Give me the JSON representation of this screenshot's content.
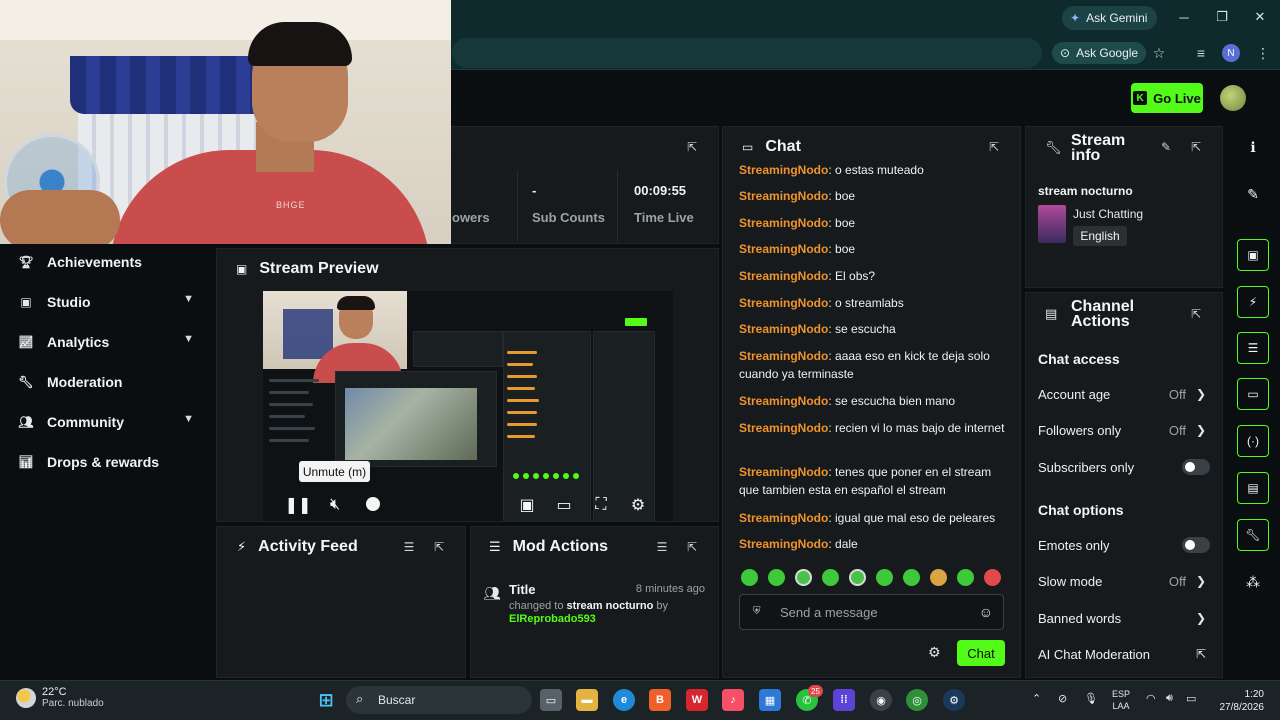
{
  "browser": {
    "ask_gemini": "Ask Gemini",
    "ask_google": "Ask Google",
    "profile_initial": "N",
    "minimize": "─",
    "maximize": "❐",
    "close": "✕"
  },
  "header": {
    "go_live_label": "Go Live",
    "go_live_logo": "K"
  },
  "webcam": {
    "shirt_text": "BHGE"
  },
  "sidebar": {
    "items": [
      {
        "label": "Achievements",
        "icon": "trophy-icon",
        "expandable": false
      },
      {
        "label": "Studio",
        "icon": "studio-icon",
        "expandable": true
      },
      {
        "label": "Analytics",
        "icon": "analytics-icon",
        "expandable": true
      },
      {
        "label": "Moderation",
        "icon": "wrench-icon",
        "expandable": false
      },
      {
        "label": "Community",
        "icon": "community-icon",
        "expandable": true
      },
      {
        "label": "Drops & rewards",
        "icon": "chart-icon",
        "expandable": false
      }
    ]
  },
  "stats": {
    "partial_label": "owers",
    "sub_counts_value": "-",
    "sub_counts_label": "Sub Counts",
    "time_live_value": "00:09:55",
    "time_live_label": "Time Live"
  },
  "stream_preview": {
    "title": "Stream Preview",
    "tooltip": "Unmute (m)"
  },
  "activity_feed": {
    "title": "Activity Feed"
  },
  "mod_actions": {
    "title": "Mod Actions",
    "entries": [
      {
        "title": "Title",
        "time": "8 minutes ago",
        "prefix": "changed to ",
        "value": "stream nocturno",
        "by": " by",
        "user": "ElReprobado593"
      }
    ]
  },
  "chat": {
    "title": "Chat",
    "messages": [
      {
        "user": "StreamingNodo",
        "text": "o estas muteado"
      },
      {
        "user": "StreamingNodo",
        "text": "boe"
      },
      {
        "user": "StreamingNodo",
        "text": "boe"
      },
      {
        "user": "StreamingNodo",
        "text": "boe"
      },
      {
        "user": "StreamingNodo",
        "text": "El obs?"
      },
      {
        "user": "StreamingNodo",
        "text": "o streamlabs"
      },
      {
        "user": "StreamingNodo",
        "text": "se escucha"
      },
      {
        "user": "StreamingNodo",
        "text": "aaaa eso en kick te deja solo cuando ya terminaste"
      },
      {
        "user": "StreamingNodo",
        "text": "se escucha bien mano"
      },
      {
        "user": "StreamingNodo",
        "text": "recien vi lo mas bajo de internet"
      },
      {
        "user": "StreamingNodo",
        "text": "tenes que poner en el stream que tambien esta en español el stream"
      },
      {
        "user": "StreamingNodo",
        "text": "igual que mal eso de peleares"
      },
      {
        "user": "StreamingNodo",
        "text": "dale"
      }
    ],
    "input_placeholder": "Send a message",
    "send_label": "Chat"
  },
  "stream_info": {
    "title_line1": "Stream",
    "title_line2": "info",
    "stream_title": "stream nocturno",
    "category": "Just Chatting",
    "language": "English"
  },
  "channel_actions": {
    "title_line1": "Channel",
    "title_line2": "Actions",
    "chat_access_heading": "Chat access",
    "account_age": {
      "label": "Account age",
      "value": "Off"
    },
    "followers_only": {
      "label": "Followers only",
      "value": "Off"
    },
    "subscribers_only": {
      "label": "Subscribers only",
      "enabled": false
    },
    "chat_options_heading": "Chat options",
    "emotes_only": {
      "label": "Emotes only",
      "enabled": false
    },
    "slow_mode": {
      "label": "Slow mode",
      "value": "Off"
    },
    "banned_words": {
      "label": "Banned words"
    },
    "ai_moderation": {
      "label": "AI Chat Moderation"
    }
  },
  "taskbar": {
    "temperature": "22°C",
    "weather": "Parc. nublado",
    "search_label": "Buscar",
    "whatsapp_badge": "25",
    "language_line1": "ESP",
    "language_line2": "LAA",
    "time": "1:20",
    "date": "27/8/2026"
  },
  "colors": {
    "accent": "#53fc18",
    "username": "#f0932b",
    "panel": "#161a1d",
    "background": "#0b0e11"
  }
}
